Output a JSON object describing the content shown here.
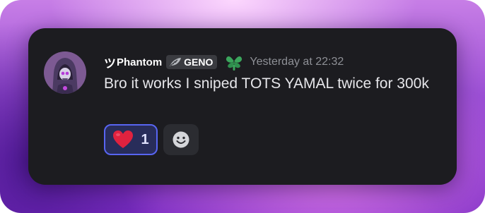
{
  "message": {
    "author": {
      "name_prefix": "ツ",
      "name": "Phantom",
      "avatar_icon": "hooded-skull-avatar"
    },
    "server_tag": {
      "icon": "feather-quill-icon",
      "label": "GENO"
    },
    "role_badge_icon": "green-leaf-badge-icon",
    "timestamp": "Yesterday at 22:32",
    "text": "Bro it works I sniped TOTS YAMAL twice for 300k",
    "reactions": [
      {
        "emoji": "red-heart-icon",
        "count": "1",
        "reacted": true
      }
    ],
    "add_reaction_icon": "smiley-add-reaction-icon"
  },
  "colors": {
    "card_background": "#1c1c20",
    "reaction_border": "#5865f2",
    "timestamp": "#8e9096",
    "badge_green": "#3ba55c",
    "heart_red": "#e0223f"
  }
}
